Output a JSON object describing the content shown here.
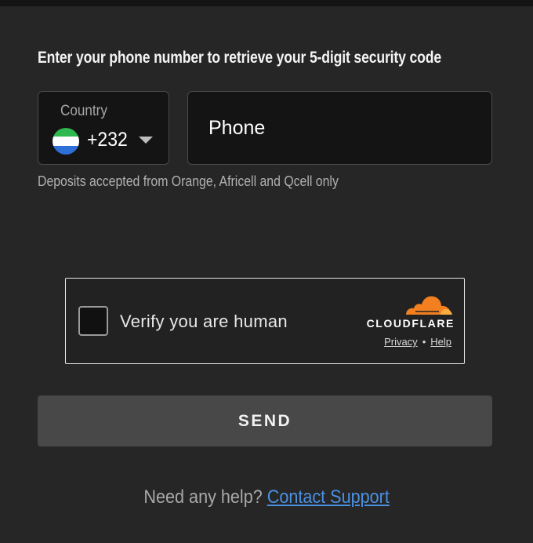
{
  "form": {
    "instruction": "Enter your phone number to retrieve your 5-digit security code",
    "country": {
      "label": "Country",
      "dial_code": "+232",
      "flag_icon": "sierra-leone-flag-icon",
      "flag_colors": [
        "#2fb84f",
        "#ffffff",
        "#2f6fd8"
      ]
    },
    "phone": {
      "placeholder": "Phone",
      "value": ""
    },
    "note": "Deposits accepted from Orange, Africell and Qcell only"
  },
  "captcha": {
    "label": "Verify you are human",
    "brand": "CLOUDFLARE",
    "brand_color": "#f38020",
    "privacy_link": "Privacy",
    "separator": "•",
    "help_link": "Help"
  },
  "actions": {
    "send_label": "SEND"
  },
  "support": {
    "prompt": "Need any help?",
    "link_text": "Contact Support",
    "link_color": "#4a90e2"
  }
}
